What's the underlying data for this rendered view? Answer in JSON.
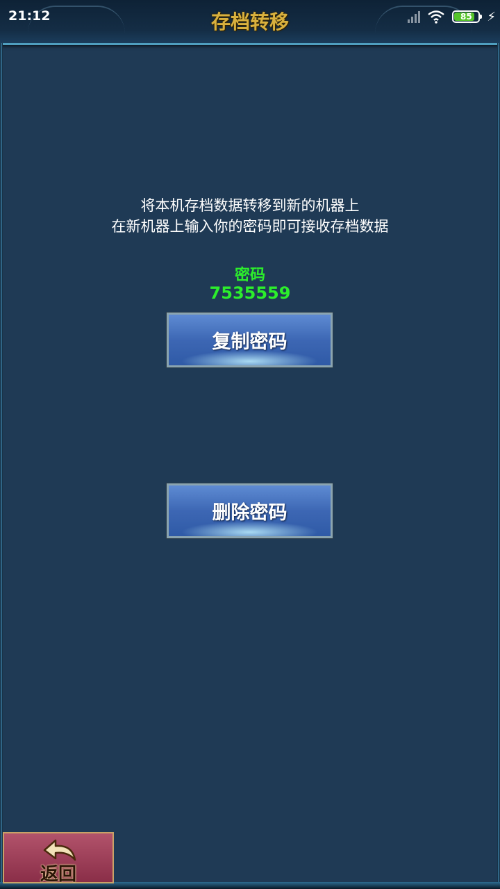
{
  "status_bar": {
    "time": "21:12",
    "battery": "85",
    "battery_level": 0.85,
    "icons": [
      "signal-icon",
      "wifi-icon",
      "battery-icon",
      "charging-icon"
    ]
  },
  "header": {
    "title": "存档转移"
  },
  "main": {
    "description_line1": "将本机存档数据转移到新的机器上",
    "description_line2": "在新机器上输入你的密码即可接收存档数据",
    "password_label": "密码",
    "password_value": "7535559",
    "copy_button": "复制密码",
    "delete_button": "删除密码"
  },
  "footer": {
    "back_label": "返回"
  },
  "colors": {
    "background": "#1f3a55",
    "title": "#d9b13e",
    "password": "#2cee2c",
    "button": "#3d67b4",
    "back_button": "#9a3b57"
  }
}
